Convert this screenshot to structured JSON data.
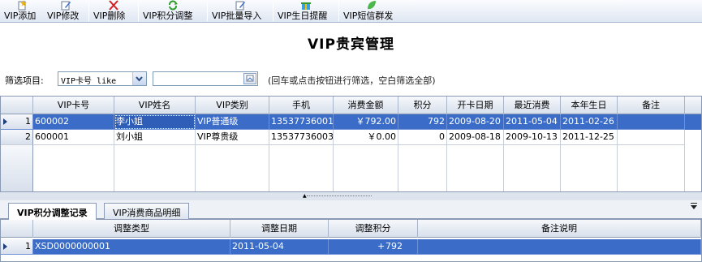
{
  "toolbar": {
    "buttons": [
      {
        "label": "VIP添加",
        "icon": "add-icon"
      },
      {
        "label": "VIP修改",
        "icon": "edit-icon"
      },
      {
        "label": "VIP删除",
        "icon": "delete-icon"
      },
      {
        "label": "VIP积分调整",
        "icon": "refresh-icon"
      },
      {
        "label": "VIP批量导入",
        "icon": "import-icon"
      },
      {
        "label": "VIP生日提醒",
        "icon": "gift-icon"
      },
      {
        "label": "VIP短信群发",
        "icon": "leaf-icon"
      }
    ]
  },
  "page": {
    "title": "VIP贵宾管理"
  },
  "filter": {
    "label": "筛选项目:",
    "field_value": "VIP卡号 like",
    "input_value": "",
    "hint": "(回车或点击按钮进行筛选，空白筛选全部)"
  },
  "main_grid": {
    "columns": [
      "VIP卡号",
      "VIP姓名",
      "VIP类别",
      "手机",
      "消费金额",
      "积分",
      "开卡日期",
      "最近消费",
      "本年生日",
      "备注"
    ],
    "rows": [
      {
        "num": "1",
        "card": "600002",
        "name": "李小姐",
        "type": "VIP普通级",
        "phone": "13537736001",
        "amount": "￥792.00",
        "points": "792",
        "open": "2009-08-20",
        "last": "2011-05-04",
        "birthday": "2011-02-26",
        "note": ""
      },
      {
        "num": "2",
        "card": "600001",
        "name": "刘小姐",
        "type": "VIP尊贵级",
        "phone": "13537736003",
        "amount": "￥0.00",
        "points": "0",
        "open": "2009-08-18",
        "last": "2009-10-13",
        "birthday": "2011-12-25",
        "note": ""
      }
    ]
  },
  "tabs": [
    {
      "label": "VIP积分调整记录",
      "active": true
    },
    {
      "label": "VIP消费商品明细",
      "active": false
    }
  ],
  "sub_grid": {
    "columns": [
      "调整类型",
      "调整日期",
      "调整积分",
      "备注说明"
    ],
    "rows": [
      {
        "num": "1",
        "type": "XSD0000000001",
        "date": "2011-05-04",
        "sign": "+",
        "points": "792",
        "note": ""
      }
    ]
  },
  "colors": {
    "selection": "#3a6cc8",
    "header": "#d8e0ec"
  }
}
